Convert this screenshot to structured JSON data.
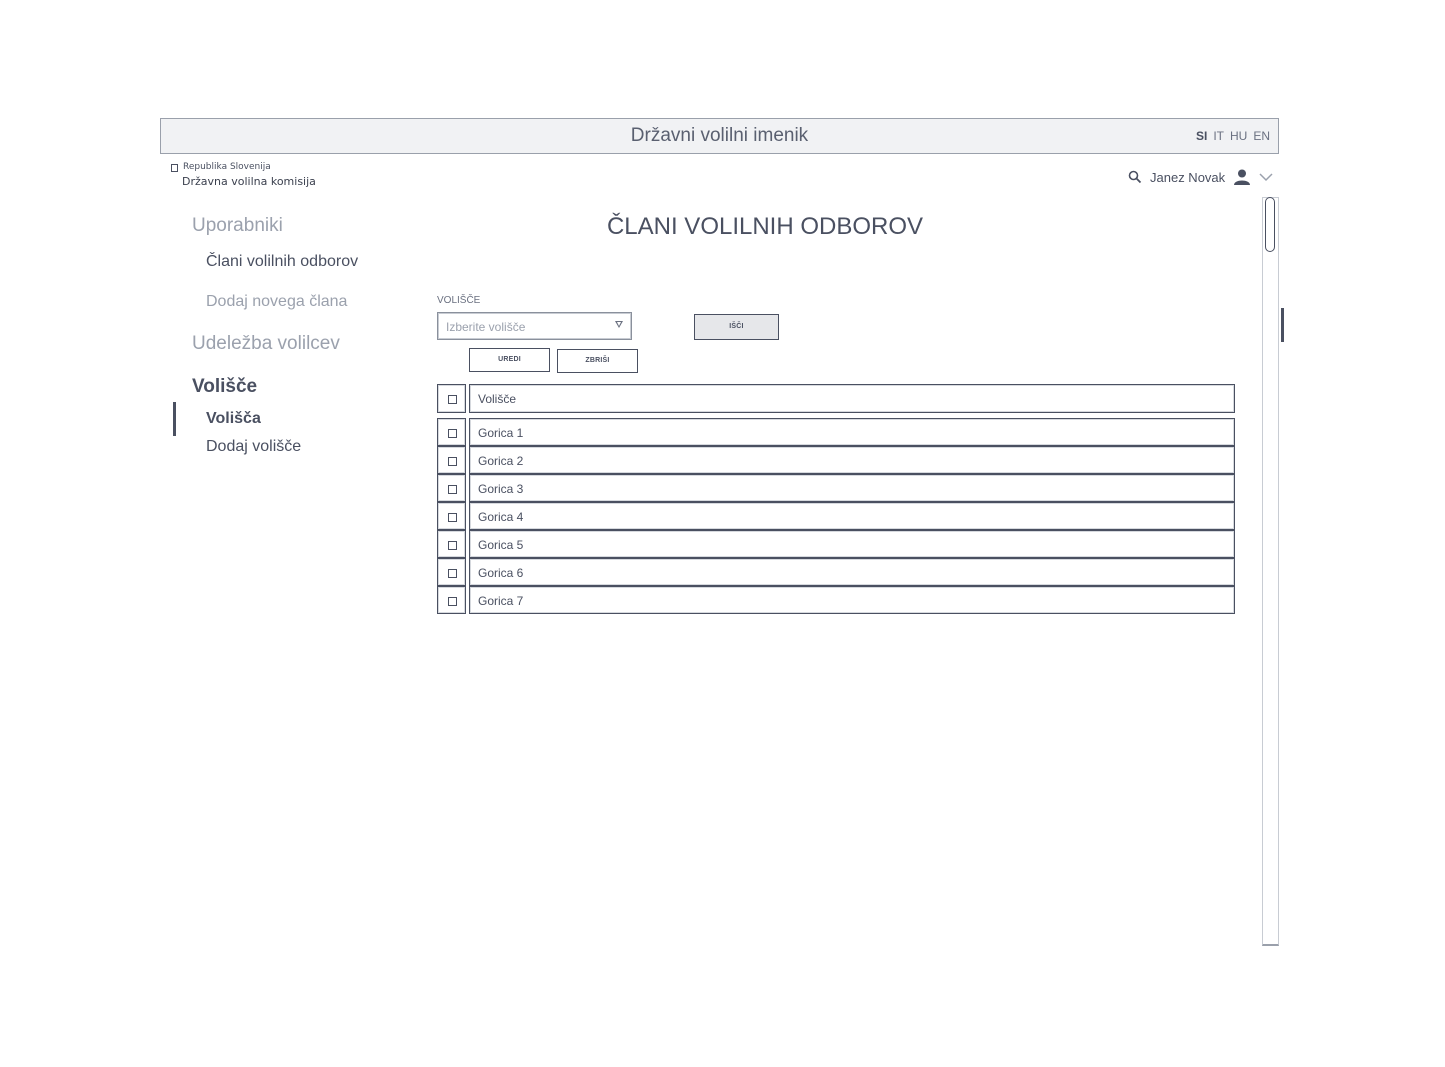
{
  "header": {
    "title": "Državni volilni imenik",
    "languages": [
      "SI",
      "IT",
      "HU",
      "EN"
    ],
    "active_language": "SI"
  },
  "logo": {
    "line1": "Republika Slovenija",
    "line2": "Državna volilna komisija"
  },
  "user": {
    "name": "Janez Novak",
    "icons": [
      "search-icon",
      "user-icon",
      "chevron-down-icon"
    ]
  },
  "sidebar": {
    "sections": [
      {
        "label": "Uporabniki",
        "items": [
          {
            "label": "Člani volilnih odborov"
          },
          {
            "label": "Dodaj novega člana"
          }
        ]
      },
      {
        "label": "Udeležba volilcev",
        "items": []
      },
      {
        "label": "Volišče",
        "items": [
          {
            "label": "Volišča"
          },
          {
            "label": "Dodaj volišče"
          }
        ]
      }
    ]
  },
  "main": {
    "title": "ČLANI VOLILNIH ODBOROV",
    "filter": {
      "label": "VOLIŠČE",
      "placeholder": "Izberite volišče",
      "search_label": "IŠČI"
    },
    "actions": {
      "edit_label": "UREDI",
      "delete_label": "ZBRIŠI"
    },
    "table": {
      "header": "Volišče",
      "rows": [
        "Gorica 1",
        "Gorica 2",
        "Gorica 3",
        "Gorica 4",
        "Gorica 5",
        "Gorica 6",
        "Gorica 7"
      ]
    }
  },
  "colors": {
    "text": "#4a5061",
    "muted": "#9ba1ad",
    "header_bg": "#f1f2f4",
    "border": "#4a5061"
  }
}
